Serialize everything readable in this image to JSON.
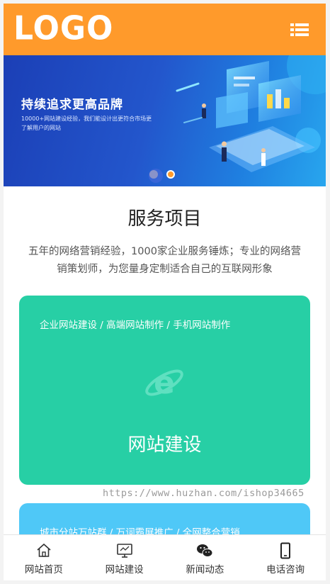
{
  "header": {
    "logo_text": "LOGO",
    "menu_icon": "list-menu-icon",
    "bg_color": "#ff9a2b"
  },
  "banner": {
    "title": "持续追求更高品牌",
    "subtitle": "10000+网站建设经验，我们能设计出更符合市场更了解用户的网站",
    "slide_count": 2,
    "active_slide": 2
  },
  "services": {
    "title": "服务项目",
    "description": "五年的网络营销经验，1000家企业服务锤炼；专业的网络营销策划师，为您量身定制适合自己的互联网形象",
    "cards": [
      {
        "tags": "企业网站建设 / 高端网站制作 / 手机网站制作",
        "icon": "ie-browser-icon",
        "name": "网站建设",
        "color": "#27cfa5"
      },
      {
        "tags": "城市分站万站群 / 万词霸屏推广 / 全网整合营销",
        "color": "#4fc8f7"
      }
    ]
  },
  "watermark": "https://www.huzhan.com/ishop34665",
  "bottom_nav": [
    {
      "label": "网站首页",
      "icon": "home-icon"
    },
    {
      "label": "网站建设",
      "icon": "monitor-icon"
    },
    {
      "label": "新闻动态",
      "icon": "wechat-icon"
    },
    {
      "label": "电话咨询",
      "icon": "phone-icon"
    }
  ]
}
